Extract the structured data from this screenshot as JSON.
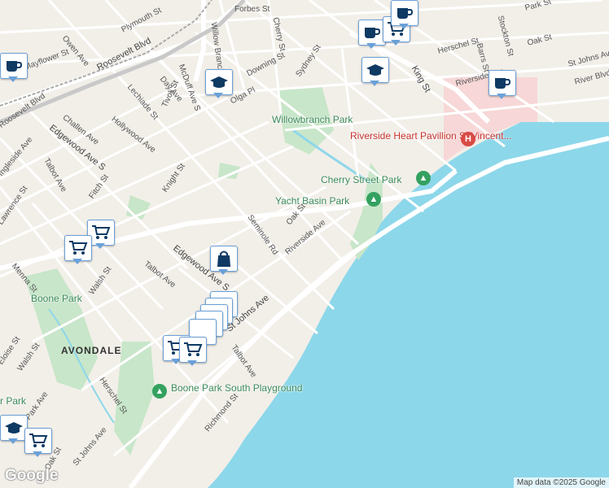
{
  "map": {
    "attribution": "Map data ©2025 Google",
    "logo": "Google",
    "colors": {
      "water": "#8dd7ea",
      "park": "#c8e6c9",
      "land": "#f2efe9",
      "road": "#ffffff",
      "hospital_zone": "#f7d7d7",
      "marker_border": "#6aa0d8",
      "icon_navy": "#0e3a63",
      "park_pin": "#34a160",
      "hospital_pin": "#d94a44"
    }
  },
  "streets": [
    {
      "name": "Forbes St"
    },
    {
      "name": "Plymouth St"
    },
    {
      "name": "Cherry St"
    },
    {
      "name": "Willow Branch Ave"
    },
    {
      "name": "Park St"
    },
    {
      "name": "Stockton St"
    },
    {
      "name": "Owen Ave"
    },
    {
      "name": "Roosevelt Blvd"
    },
    {
      "name": "McDuff Ave S"
    },
    {
      "name": "Mayflower St"
    },
    {
      "name": "Lechiade St"
    },
    {
      "name": "Day Ave"
    },
    {
      "name": "Downing St"
    },
    {
      "name": "Sydney St"
    },
    {
      "name": "Herschel St"
    },
    {
      "name": "Barrs St"
    },
    {
      "name": "Oak St"
    },
    {
      "name": "St Johns Ave"
    },
    {
      "name": "River Blvd"
    },
    {
      "name": "King St"
    },
    {
      "name": "Riverside Ave"
    },
    {
      "name": "Tivoli St"
    },
    {
      "name": "Olga Pl"
    },
    {
      "name": "Hollywood Ave"
    },
    {
      "name": "Challen Ave"
    },
    {
      "name": "Roosevelt Blvd"
    },
    {
      "name": "Edgewood Ave S"
    },
    {
      "name": "Ingleside Ave"
    },
    {
      "name": "Talbot Ave"
    },
    {
      "name": "Fitch St"
    },
    {
      "name": "Knight St"
    },
    {
      "name": "Lawrence St"
    },
    {
      "name": "Seminole Rd"
    },
    {
      "name": "Oak St"
    },
    {
      "name": "Riverside Ave"
    },
    {
      "name": "Edgewood Ave S"
    },
    {
      "name": "Talbot Ave"
    },
    {
      "name": "Menna St"
    },
    {
      "name": "Walsh St"
    },
    {
      "name": "St Johns Ave"
    },
    {
      "name": "Talbot Ave"
    },
    {
      "name": "Eloise St"
    },
    {
      "name": "Walsh St"
    },
    {
      "name": "Herschel St"
    },
    {
      "name": "Park Ave"
    },
    {
      "name": "Richmond St"
    },
    {
      "name": "Oak St"
    },
    {
      "name": "St Johns Ave"
    }
  ],
  "places": {
    "willowbranch_park": "Willowbranch Park",
    "riverside_heart": "Riverside Heart Pavillion St Vincent...",
    "cherry_street_park": "Cherry Street Park",
    "yacht_basin_park": "Yacht Basin Park",
    "boone_park": "Boone Park",
    "boone_park_south": "Boone Park South Playground",
    "avondale": "AVONDALE",
    "partial_park": "r Park"
  },
  "markers": [
    {
      "icon": "cafe-icon"
    },
    {
      "icon": "cafe-icon"
    },
    {
      "icon": "shopping-cart-icon"
    },
    {
      "icon": "cafe-icon"
    },
    {
      "icon": "school-icon"
    },
    {
      "icon": "school-icon"
    },
    {
      "icon": "cafe-icon"
    },
    {
      "icon": "shopping-cart-icon"
    },
    {
      "icon": "shopping-cart-icon"
    },
    {
      "icon": "shopping-bag-icon"
    },
    {
      "icon": "shopping-cart-icon"
    },
    {
      "icon": "shopping-cart-icon"
    },
    {
      "icon": "school-icon"
    },
    {
      "icon": "shopping-cart-icon"
    }
  ]
}
